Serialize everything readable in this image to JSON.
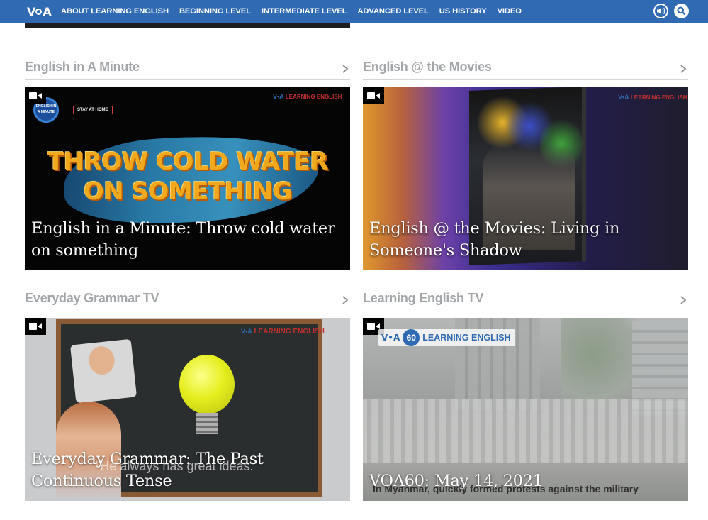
{
  "header": {
    "logo": "VOA",
    "nav": [
      "ABOUT LEARNING ENGLISH",
      "BEGINNING LEVEL",
      "INTERMEDIATE LEVEL",
      "ADVANCED LEVEL",
      "US HISTORY",
      "VIDEO"
    ],
    "icons": [
      "audio-icon",
      "search-icon"
    ]
  },
  "sections": [
    {
      "title": "English in A Minute",
      "card": {
        "title": "English in a Minute: Throw cold water on something",
        "thumb_text": "THROW COLD WATER ON SOMETHING",
        "badge": "ENGLISH IN A MINUTE",
        "tag": "STAY AT HOME",
        "brand": "LEARNING ENGLISH"
      }
    },
    {
      "title": "English @ the Movies",
      "card": {
        "title": "English @ the Movies: Living in Someone's Shadow",
        "brand": "LEARNING ENGLISH"
      }
    },
    {
      "title": "Everyday Grammar TV",
      "card": {
        "title": "Everyday Grammar: The Past Continuous Tense",
        "caption": "\"He always has great ideas.\"",
        "brand": "LEARNING ENGLISH"
      }
    },
    {
      "title": "Learning English TV",
      "card": {
        "title": "VOA60: May 14, 2021",
        "logo_num": "60",
        "brand": "LEARNING ENGLISH",
        "subtitle": "In Myanmar, quickly formed protests against the military"
      }
    }
  ],
  "colors": {
    "nav_bg": "#2f6ab3",
    "section_title": "#a3a6a8",
    "divider": "#d5d6d7"
  }
}
